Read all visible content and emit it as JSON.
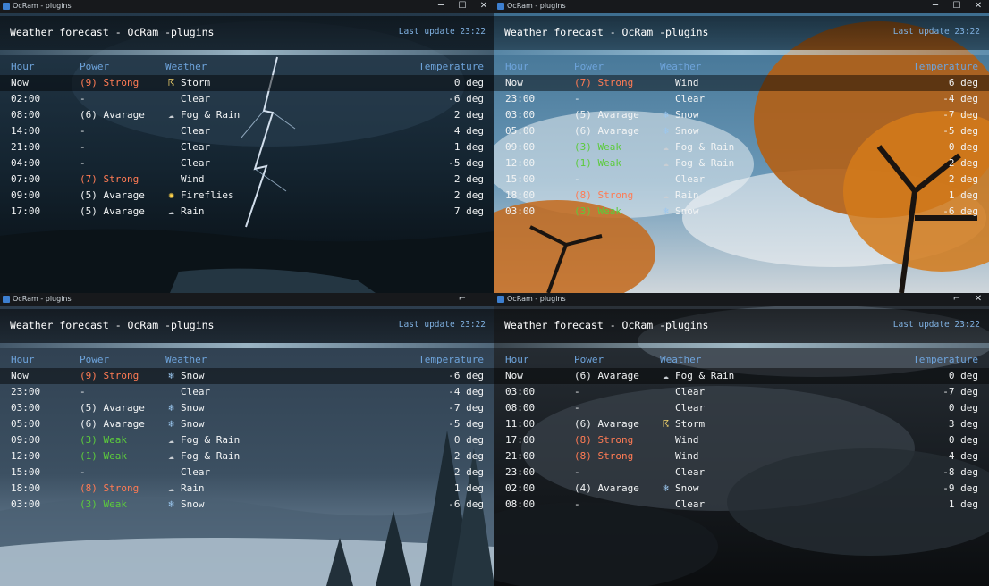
{
  "windows": [
    {
      "window_title": "OcRam - plugins",
      "title": "Weather forecast - OcRam -plugins",
      "last_update": "Last update 23:22",
      "columns": {
        "hour": "Hour",
        "power": "Power",
        "weather": "Weather",
        "temperature": "Temperature"
      },
      "controls": {
        "minimize": "─",
        "maximize": "☐",
        "close": "✕"
      },
      "theme": "storm",
      "rows": [
        {
          "hour": "Now",
          "power": "(9) Strong",
          "level": "strong",
          "icon": "storm-icon",
          "glyph": "☈",
          "weather": "Storm",
          "temp": "0 deg"
        },
        {
          "hour": "02:00",
          "power": "-",
          "level": "none",
          "icon": "",
          "glyph": "",
          "weather": "Clear",
          "temp": "-6 deg"
        },
        {
          "hour": "08:00",
          "power": "(6) Avarage",
          "level": "avg",
          "icon": "fog-rain-icon",
          "glyph": "☁",
          "weather": "Fog & Rain",
          "temp": "2 deg"
        },
        {
          "hour": "14:00",
          "power": "-",
          "level": "none",
          "icon": "",
          "glyph": "",
          "weather": "Clear",
          "temp": "4 deg"
        },
        {
          "hour": "21:00",
          "power": "-",
          "level": "none",
          "icon": "",
          "glyph": "",
          "weather": "Clear",
          "temp": "1 deg"
        },
        {
          "hour": "04:00",
          "power": "-",
          "level": "none",
          "icon": "",
          "glyph": "",
          "weather": "Clear",
          "temp": "-5 deg"
        },
        {
          "hour": "07:00",
          "power": "(7) Strong",
          "level": "strong",
          "icon": "",
          "glyph": "",
          "weather": "Wind",
          "temp": "2 deg"
        },
        {
          "hour": "09:00",
          "power": "(5) Avarage",
          "level": "avg",
          "icon": "fireflies-icon",
          "glyph": "✺",
          "weather": "Fireflies",
          "temp": "2 deg"
        },
        {
          "hour": "17:00",
          "power": "(5) Avarage",
          "level": "avg",
          "icon": "rain-icon",
          "glyph": "☁",
          "weather": "Rain",
          "temp": "7 deg"
        }
      ]
    },
    {
      "window_title": "OcRam - plugins",
      "title": "Weather forecast - OcRam -plugins",
      "last_update": "Last update 23:22",
      "columns": {
        "hour": "Hour",
        "power": "Power",
        "weather": "Weather",
        "temperature": "Temperature"
      },
      "controls": {
        "minimize": "─",
        "maximize": "☐",
        "close": "✕"
      },
      "theme": "autumn",
      "rows": [
        {
          "hour": "Now",
          "power": "(7) Strong",
          "level": "strong",
          "icon": "",
          "glyph": "",
          "weather": "Wind",
          "temp": "6 deg"
        },
        {
          "hour": "23:00",
          "power": "-",
          "level": "none",
          "icon": "",
          "glyph": "",
          "weather": "Clear",
          "temp": "-4 deg"
        },
        {
          "hour": "03:00",
          "power": "(5) Avarage",
          "level": "avg",
          "icon": "snow-icon",
          "glyph": "❄",
          "weather": "Snow",
          "temp": "-7 deg"
        },
        {
          "hour": "05:00",
          "power": "(6) Avarage",
          "level": "avg",
          "icon": "snow-icon",
          "glyph": "❄",
          "weather": "Snow",
          "temp": "-5 deg"
        },
        {
          "hour": "09:00",
          "power": "(3) Weak",
          "level": "weak",
          "icon": "fog-rain-icon",
          "glyph": "☁",
          "weather": "Fog & Rain",
          "temp": "0 deg"
        },
        {
          "hour": "12:00",
          "power": "(1) Weak",
          "level": "weak",
          "icon": "fog-rain-icon",
          "glyph": "☁",
          "weather": "Fog & Rain",
          "temp": "2 deg"
        },
        {
          "hour": "15:00",
          "power": "-",
          "level": "none",
          "icon": "",
          "glyph": "",
          "weather": "Clear",
          "temp": "2 deg"
        },
        {
          "hour": "18:00",
          "power": "(8) Strong",
          "level": "strong",
          "icon": "rain-icon",
          "glyph": "☁",
          "weather": "Rain",
          "temp": "1 deg"
        },
        {
          "hour": "03:00",
          "power": "(3) Weak",
          "level": "weak",
          "icon": "snow-icon",
          "glyph": "❄",
          "weather": "Snow",
          "temp": "-6 deg"
        }
      ]
    },
    {
      "window_title": "OcRam - plugins",
      "title": "Weather forecast - OcRam -plugins",
      "last_update": "Last update 23:22",
      "columns": {
        "hour": "Hour",
        "power": "Power",
        "weather": "Weather",
        "temperature": "Temperature"
      },
      "controls": {
        "minimize": "",
        "maximize": "⌐",
        "close": ""
      },
      "theme": "winter",
      "rows": [
        {
          "hour": "Now",
          "power": "(9) Strong",
          "level": "strong",
          "icon": "snow-icon",
          "glyph": "❄",
          "weather": "Snow",
          "temp": "-6 deg"
        },
        {
          "hour": "23:00",
          "power": "-",
          "level": "none",
          "icon": "",
          "glyph": "",
          "weather": "Clear",
          "temp": "-4 deg"
        },
        {
          "hour": "03:00",
          "power": "(5) Avarage",
          "level": "avg",
          "icon": "snow-icon",
          "glyph": "❄",
          "weather": "Snow",
          "temp": "-7 deg"
        },
        {
          "hour": "05:00",
          "power": "(6) Avarage",
          "level": "avg",
          "icon": "snow-icon",
          "glyph": "❄",
          "weather": "Snow",
          "temp": "-5 deg"
        },
        {
          "hour": "09:00",
          "power": "(3) Weak",
          "level": "weak",
          "icon": "fog-rain-icon",
          "glyph": "☁",
          "weather": "Fog & Rain",
          "temp": "0 deg"
        },
        {
          "hour": "12:00",
          "power": "(1) Weak",
          "level": "weak",
          "icon": "fog-rain-icon",
          "glyph": "☁",
          "weather": "Fog & Rain",
          "temp": "2 deg"
        },
        {
          "hour": "15:00",
          "power": "-",
          "level": "none",
          "icon": "",
          "glyph": "",
          "weather": "Clear",
          "temp": "2 deg"
        },
        {
          "hour": "18:00",
          "power": "(8) Strong",
          "level": "strong",
          "icon": "rain-icon",
          "glyph": "☁",
          "weather": "Rain",
          "temp": "1 deg"
        },
        {
          "hour": "03:00",
          "power": "(3) Weak",
          "level": "weak",
          "icon": "snow-icon",
          "glyph": "❄",
          "weather": "Snow",
          "temp": "-6 deg"
        }
      ]
    },
    {
      "window_title": "OcRam - plugins",
      "title": "Weather forecast - OcRam -plugins",
      "last_update": "Last update 23:22",
      "columns": {
        "hour": "Hour",
        "power": "Power",
        "weather": "Weather",
        "temperature": "Temperature"
      },
      "controls": {
        "minimize": "",
        "maximize": "⌐",
        "close": "✕"
      },
      "theme": "clouds",
      "rows": [
        {
          "hour": "Now",
          "power": "(6) Avarage",
          "level": "avg",
          "icon": "fog-rain-icon",
          "glyph": "☁",
          "weather": "Fog & Rain",
          "temp": "0 deg"
        },
        {
          "hour": "03:00",
          "power": "-",
          "level": "none",
          "icon": "",
          "glyph": "",
          "weather": "Clear",
          "temp": "-7 deg"
        },
        {
          "hour": "08:00",
          "power": "-",
          "level": "none",
          "icon": "",
          "glyph": "",
          "weather": "Clear",
          "temp": "0 deg"
        },
        {
          "hour": "11:00",
          "power": "(6) Avarage",
          "level": "avg",
          "icon": "storm-icon",
          "glyph": "☈",
          "weather": "Storm",
          "temp": "3 deg"
        },
        {
          "hour": "17:00",
          "power": "(8) Strong",
          "level": "strong",
          "icon": "",
          "glyph": "",
          "weather": "Wind",
          "temp": "0 deg"
        },
        {
          "hour": "21:00",
          "power": "(8) Strong",
          "level": "strong",
          "icon": "",
          "glyph": "",
          "weather": "Wind",
          "temp": "4 deg"
        },
        {
          "hour": "23:00",
          "power": "-",
          "level": "none",
          "icon": "",
          "glyph": "",
          "weather": "Clear",
          "temp": "-8 deg"
        },
        {
          "hour": "02:00",
          "power": "(4) Avarage",
          "level": "avg",
          "icon": "snow-icon",
          "glyph": "❄",
          "weather": "Snow",
          "temp": "-9 deg"
        },
        {
          "hour": "08:00",
          "power": "-",
          "level": "none",
          "icon": "",
          "glyph": "",
          "weather": "Clear",
          "temp": "1 deg"
        }
      ]
    }
  ],
  "colors": {
    "header_label": "#6ea4dc",
    "last_update": "#7fb0e0",
    "strong": "#ff7b54",
    "weak": "#5ccb3c",
    "text": "#f1f3f4",
    "icon_snow": "#9cc8f0",
    "icon_storm": "#f3d36b",
    "icon_fireflies": "#ffd34a",
    "icon_cloud": "#c9ced3"
  }
}
